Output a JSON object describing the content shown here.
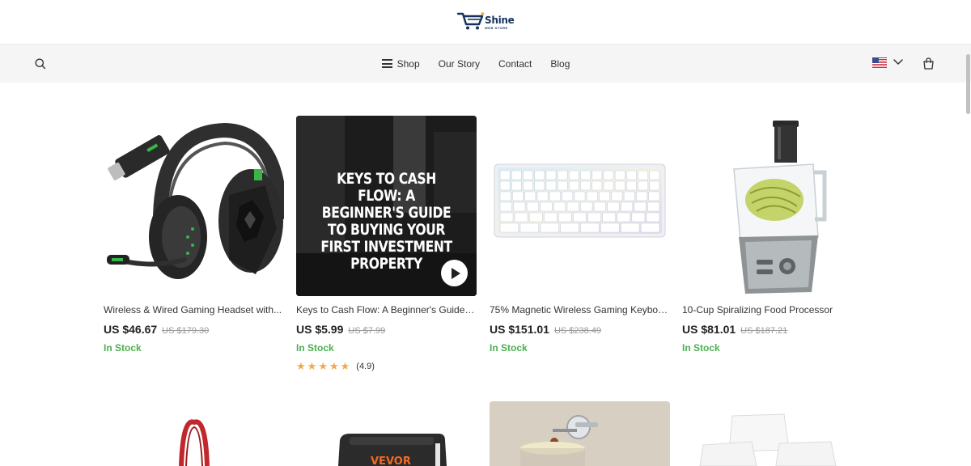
{
  "header": {
    "logo_text": "Shine",
    "logo_sub": "WEB STORE"
  },
  "nav": {
    "items": [
      {
        "label": "Shop",
        "icon": "hamburger-icon"
      },
      {
        "label": "Our Story"
      },
      {
        "label": "Contact"
      },
      {
        "label": "Blog"
      }
    ],
    "search_icon": "search-icon",
    "locale_icon": "us-flag-icon",
    "cart_icon": "shopping-bag-icon"
  },
  "products": [
    {
      "title": "Wireless & Wired Gaming Headset with...",
      "price": "US $46.67",
      "old_price": "US $179.30",
      "stock": "In Stock",
      "image": "gaming-headset"
    },
    {
      "title": "Keys to Cash Flow: A Beginner's Guide t...",
      "price": "US $5.99",
      "old_price": "US $7.99",
      "stock": "In Stock",
      "image": "ebook-cover",
      "cover_text": "Keys to Cash Flow: A Beginner's Guide to Buying Your First Investment Property",
      "rating": "(4.9)",
      "stars": 5
    },
    {
      "title": "75% Magnetic Wireless Gaming Keyboa...",
      "price": "US $151.01",
      "old_price": "US $238.49",
      "stock": "In Stock",
      "image": "white-keyboard"
    },
    {
      "title": "10-Cup Spiralizing Food Processor",
      "price": "US $81.01",
      "old_price": "US $187.21",
      "stock": "In Stock",
      "image": "food-processor"
    }
  ],
  "second_row": [
    {
      "image": "red-tote-bag"
    },
    {
      "image": "tool-case",
      "brand_text": "VEVOR"
    },
    {
      "image": "wall-lamp"
    },
    {
      "image": "white-plates"
    }
  ],
  "colors": {
    "stock_green": "#4caf50",
    "star_orange": "#f0a94c",
    "logo_navy": "#17315e"
  }
}
